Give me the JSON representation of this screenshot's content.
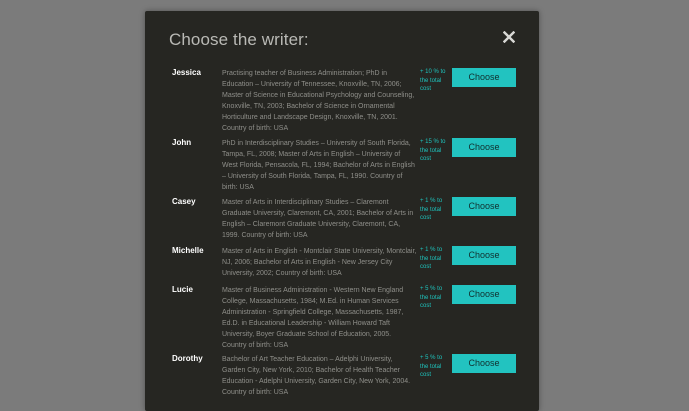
{
  "modal": {
    "title": "Choose the writer:",
    "close_icon": "close-icon",
    "choose_label": "Choose"
  },
  "writers": [
    {
      "name": "Jessica",
      "desc": "Practising teacher of Business Administration; PhD in Education – University of Tennessee, Knoxville, TN, 2006; Master of Science in Educational Psychology and Counseling, Knoxville, TN, 2003; Bachelor of Science in Ornamental Horticulture and Landscape Design, Knoxville, TN, 2001. Country of birth: USA",
      "fee": "+ 10 % to the total cost"
    },
    {
      "name": "John",
      "desc": "PhD in Interdisciplinary Studies – University of South Florida, Tampa, FL, 2008; Master of Arts in English – University of West Florida, Pensacola, FL, 1994; Bachelor of Arts in English – University of South Florida, Tampa, FL, 1990. Country of birth: USA",
      "fee": "+ 15 % to the total cost"
    },
    {
      "name": "Casey",
      "desc": "Master of Arts in Interdisciplinary Studies – Claremont Graduate University, Claremont, CA, 2001; Bachelor of Arts in English – Claremont Graduate University, Claremont, CA, 1999. Country of birth: USA",
      "fee": "+ 1 % to the total cost"
    },
    {
      "name": "Michelle",
      "desc": "Master of Arts in English - Montclair State University, Montclair, NJ, 2006; Bachelor of Arts in English - New Jersey City University, 2002; Country of birth: USA",
      "fee": "+ 1 % to the total cost"
    },
    {
      "name": "Lucie",
      "desc": "Master of Business Administration - Western New England College, Massachusetts, 1984; M.Ed. in Human Services Administration - Springfield College, Massachusetts, 1987, Ed.D. in Educational Leadership - William Howard Taft University, Boyer Graduate School of Education, 2005. Country of birth: USA",
      "fee": "+ 5 % to the total cost"
    },
    {
      "name": "Dorothy",
      "desc": "Bachelor of Art Teacher Education – Adelphi University, Garden City, New York, 2010; Bachelor of Health Teacher Education - Adelphi University, Garden City, New York, 2004. Country of birth: USA",
      "fee": "+ 5 % to the total cost"
    }
  ],
  "colors": {
    "overlay": "#7b7b7b",
    "modal_bg": "#262622",
    "accent": "#22c3c0",
    "fee_text": "#1ec3bd"
  }
}
